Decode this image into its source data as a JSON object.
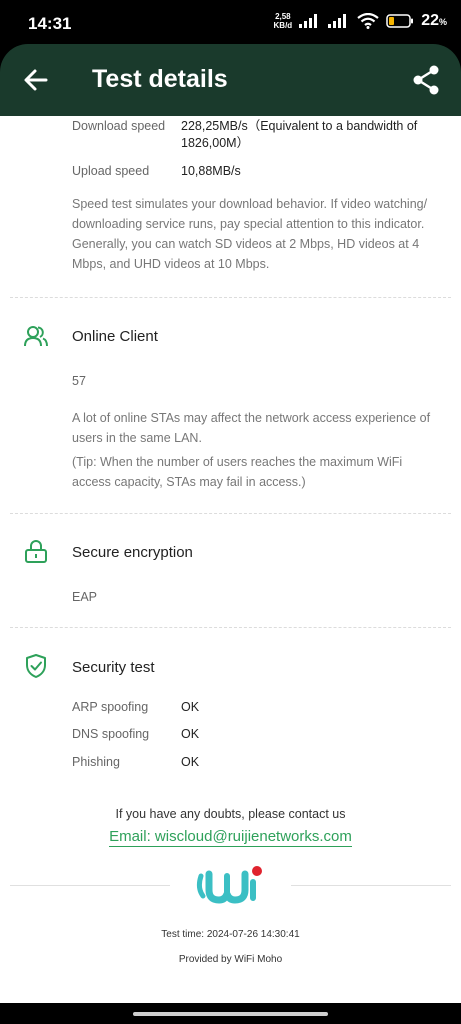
{
  "status_bar": {
    "time": "14:31",
    "net_speed_value": "2,58",
    "net_speed_unit": "KB/d",
    "battery_percent": "22",
    "battery_unit": "%"
  },
  "app_bar": {
    "title": "Test details",
    "back_icon": "arrow-left-icon",
    "share_icon": "share-icon"
  },
  "speed": {
    "download_label": "Download speed",
    "download_value": "228,25MB/s（Equivalent to a bandwidth of 1826,00M）",
    "upload_label": "Upload speed",
    "upload_value": "10,88MB/s",
    "description": "Speed test simulates your download behavior. If video watching/ downloading service runs, pay special attention to this indicator. Generally, you can watch SD videos at 2 Mbps, HD videos at 4 Mbps, and UHD videos at 10 Mbps."
  },
  "online_client": {
    "icon": "users-icon",
    "title": "Online Client",
    "value": "57",
    "description": "A lot of online STAs may affect the network access experience of users in the same LAN.",
    "tip": "(Tip: When the number of users reaches the maximum WiFi access capacity, STAs may fail in access.)"
  },
  "encryption": {
    "icon": "lock-icon",
    "title": "Secure encryption",
    "value": "EAP"
  },
  "security_test": {
    "icon": "shield-check-icon",
    "title": "Security test",
    "rows": [
      {
        "label": "ARP spoofing",
        "value": "OK"
      },
      {
        "label": "DNS spoofing",
        "value": "OK"
      },
      {
        "label": "Phishing",
        "value": "OK"
      }
    ]
  },
  "contact": {
    "text": "If you have any doubts, please contact us",
    "email": "Email: wiscloud@ruijienetworks.com"
  },
  "footer": {
    "logo": "wifi-moho-logo",
    "test_time": "Test time: 2024-07-26 14:30:41",
    "provided_by": "Provided by WiFi Moho"
  },
  "colors": {
    "app_bar": "#1a3a2c",
    "accent_green": "#2ea15a",
    "logo_teal": "#3bbfc4",
    "logo_red": "#e0232e"
  }
}
